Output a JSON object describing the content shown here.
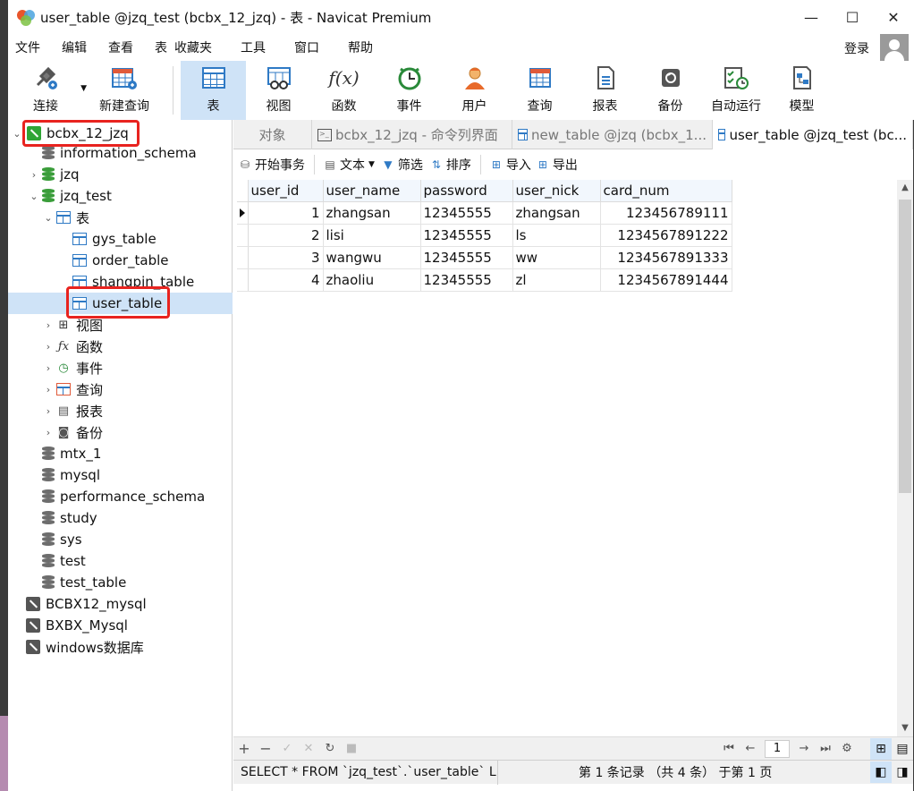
{
  "window": {
    "title": "user_table @jzq_test (bcbx_12_jzq) - 表 - Navicat Premium",
    "controls": [
      "—",
      "☐",
      "✕"
    ]
  },
  "menu": [
    "文件",
    "编辑",
    "查看",
    "表",
    "收藏夹",
    "工具",
    "窗口",
    "帮助"
  ],
  "login_label": "登录",
  "toolbar": [
    {
      "label": "连接",
      "icon": "plug-icon"
    },
    {
      "label": "新建查询",
      "icon": "new-query-icon"
    },
    {
      "label": "表",
      "icon": "table-icon",
      "active": true
    },
    {
      "label": "视图",
      "icon": "view-icon"
    },
    {
      "label": "函数",
      "icon": "function-icon",
      "glyph": "f(x)"
    },
    {
      "label": "事件",
      "icon": "clock-icon"
    },
    {
      "label": "用户",
      "icon": "user-icon"
    },
    {
      "label": "查询",
      "icon": "query-icon"
    },
    {
      "label": "报表",
      "icon": "report-icon"
    },
    {
      "label": "备份",
      "icon": "backup-icon"
    },
    {
      "label": "自动运行",
      "icon": "autorun-icon"
    },
    {
      "label": "模型",
      "icon": "model-icon"
    }
  ],
  "tree": {
    "connection": "bcbx_12_jzq",
    "items": [
      "information_schema",
      "jzq",
      "jzq_test",
      "表",
      "gys_table",
      "order_table",
      "shangpin_table",
      "user_table",
      "视图",
      "函数",
      "事件",
      "查询",
      "报表",
      "备份",
      "mtx_1",
      "mysql",
      "performance_schema",
      "study",
      "sys",
      "test",
      "test_table"
    ],
    "other_connections": [
      "BCBX12_mysql",
      "BXBX_Mysql",
      "windows数据库"
    ]
  },
  "tabs": [
    "对象",
    "bcbx_12_jzq - 命令列界面",
    "new_table @jzq (bcbx_1...",
    "user_table @jzq_test (bc..."
  ],
  "object_toolbar": [
    "开始事务",
    "文本",
    "筛选",
    "排序",
    "导入",
    "导出"
  ],
  "grid": {
    "columns": [
      "user_id",
      "user_name",
      "password",
      "user_nick",
      "card_num"
    ],
    "rows": [
      [
        "1",
        "zhangsan",
        "12345555",
        "zhangsan",
        "123456789111"
      ],
      [
        "2",
        "lisi",
        "12345555",
        "ls",
        "1234567891222"
      ],
      [
        "3",
        "wangwu",
        "12345555",
        "ww",
        "1234567891333"
      ],
      [
        "4",
        "zhaoliu",
        "12345555",
        "zl",
        "1234567891444"
      ]
    ]
  },
  "pager": {
    "page": "1"
  },
  "status": {
    "sql": "SELECT * FROM `jzq_test`.`user_table` LIMIT",
    "records": "第 1 条记录 （共 4 条） 于第 1 页"
  }
}
